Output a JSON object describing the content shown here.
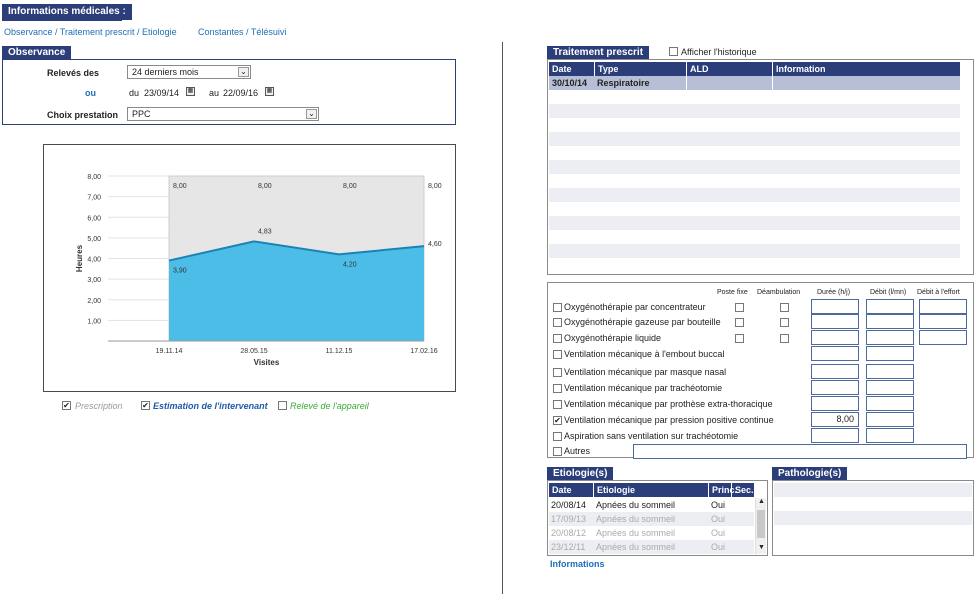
{
  "header": {
    "title": "Informations médicales :"
  },
  "nav": {
    "links": [
      "Observance / Traitement prescrit / Etiologie",
      "Constantes / Télésuivi"
    ]
  },
  "observance": {
    "tab": "Observance",
    "releves_label": "Relevés des",
    "releves_value": "24 derniers mois",
    "ou_label": "ou",
    "du_label": "du",
    "du_value": "23/09/14",
    "au_label": "au",
    "au_value": "22/09/16",
    "prestation_label": "Choix prestation",
    "prestation_value": "PPC"
  },
  "chart_data": {
    "type": "area",
    "categories": [
      "19.11.14",
      "28.05.15",
      "11.12.15",
      "17.02.16"
    ],
    "series": [
      {
        "name": "Prescription",
        "values": [
          8.0,
          8.0,
          8.0,
          8.0
        ],
        "labels": [
          "8,00",
          "8,00",
          "8,00",
          "8,00"
        ],
        "color": "#d9d9d9"
      },
      {
        "name": "Estimation de l'intervenant",
        "values": [
          3.9,
          4.83,
          4.2,
          4.6
        ],
        "labels": [
          "3,90",
          "4,83",
          "4,20",
          "4,60"
        ],
        "color": "#3bb8e6"
      }
    ],
    "yticks": [
      "8,00",
      "7,00",
      "6,00",
      "5,00",
      "4,00",
      "3,00",
      "2,00",
      "1,00"
    ],
    "ylim": [
      0,
      8
    ],
    "xlabel": "Visites",
    "ylabel": "Heures",
    "legend": [
      {
        "label": "Prescription",
        "checked": true,
        "color": "#9a9a9a"
      },
      {
        "label": "Estimation de l'intervenant",
        "checked": true,
        "color": "#1f5aa8"
      },
      {
        "label": "Relevé de l'appareil",
        "checked": false,
        "color": "#3aaa35"
      }
    ]
  },
  "traitement": {
    "tab": "Traitement prescrit",
    "historique_label": "Afficher l'historique",
    "columns": [
      "Date",
      "Type",
      "ALD",
      "Information"
    ],
    "rows": [
      [
        "30/10/14",
        "Respiratoire",
        "",
        ""
      ]
    ]
  },
  "therapies": {
    "col_headers": [
      "Poste fixe",
      "Déambulation",
      "Durée (h/j)",
      "Débit (l/mn)",
      "Débit à l'effort"
    ],
    "items": [
      {
        "label": "Oxygénothérapie par concentrateur",
        "checked": false,
        "duree": ""
      },
      {
        "label": "Oxygénothérapie gazeuse par bouteille",
        "checked": false,
        "duree": ""
      },
      {
        "label": "Oxygénothérapie liquide",
        "checked": false,
        "duree": ""
      },
      {
        "label": "Ventilation mécanique à l'embout buccal",
        "checked": false,
        "duree": ""
      },
      {
        "label": "Ventilation mécanique par masque nasal",
        "checked": false,
        "duree": ""
      },
      {
        "label": "Ventilation mécanique par trachéotomie",
        "checked": false,
        "duree": ""
      },
      {
        "label": "Ventilation mécanique par prothèse extra-thoracique",
        "checked": false,
        "duree": ""
      },
      {
        "label": "Ventilation mécanique par pression positive continue",
        "checked": true,
        "duree": "8,00"
      },
      {
        "label": "Aspiration sans ventilation sur trachéotomie",
        "checked": false,
        "duree": ""
      },
      {
        "label": "Autres",
        "checked": false,
        "duree": ""
      }
    ]
  },
  "etiologie": {
    "tab": "Etiologie(s)",
    "columns": [
      "Date",
      "Etiologie",
      "Princ.",
      "Sec."
    ],
    "rows": [
      [
        "20/08/14",
        "Apnées du sommeil",
        "Oui",
        ""
      ],
      [
        "17/09/13",
        "Apnées du sommeil",
        "Oui",
        ""
      ],
      [
        "20/08/12",
        "Apnées du sommeil",
        "Oui",
        ""
      ],
      [
        "23/12/11",
        "Apnées du sommeil",
        "Oui",
        ""
      ]
    ],
    "info_link": "Informations"
  },
  "pathologie": {
    "tab": "Pathologie(s)"
  }
}
